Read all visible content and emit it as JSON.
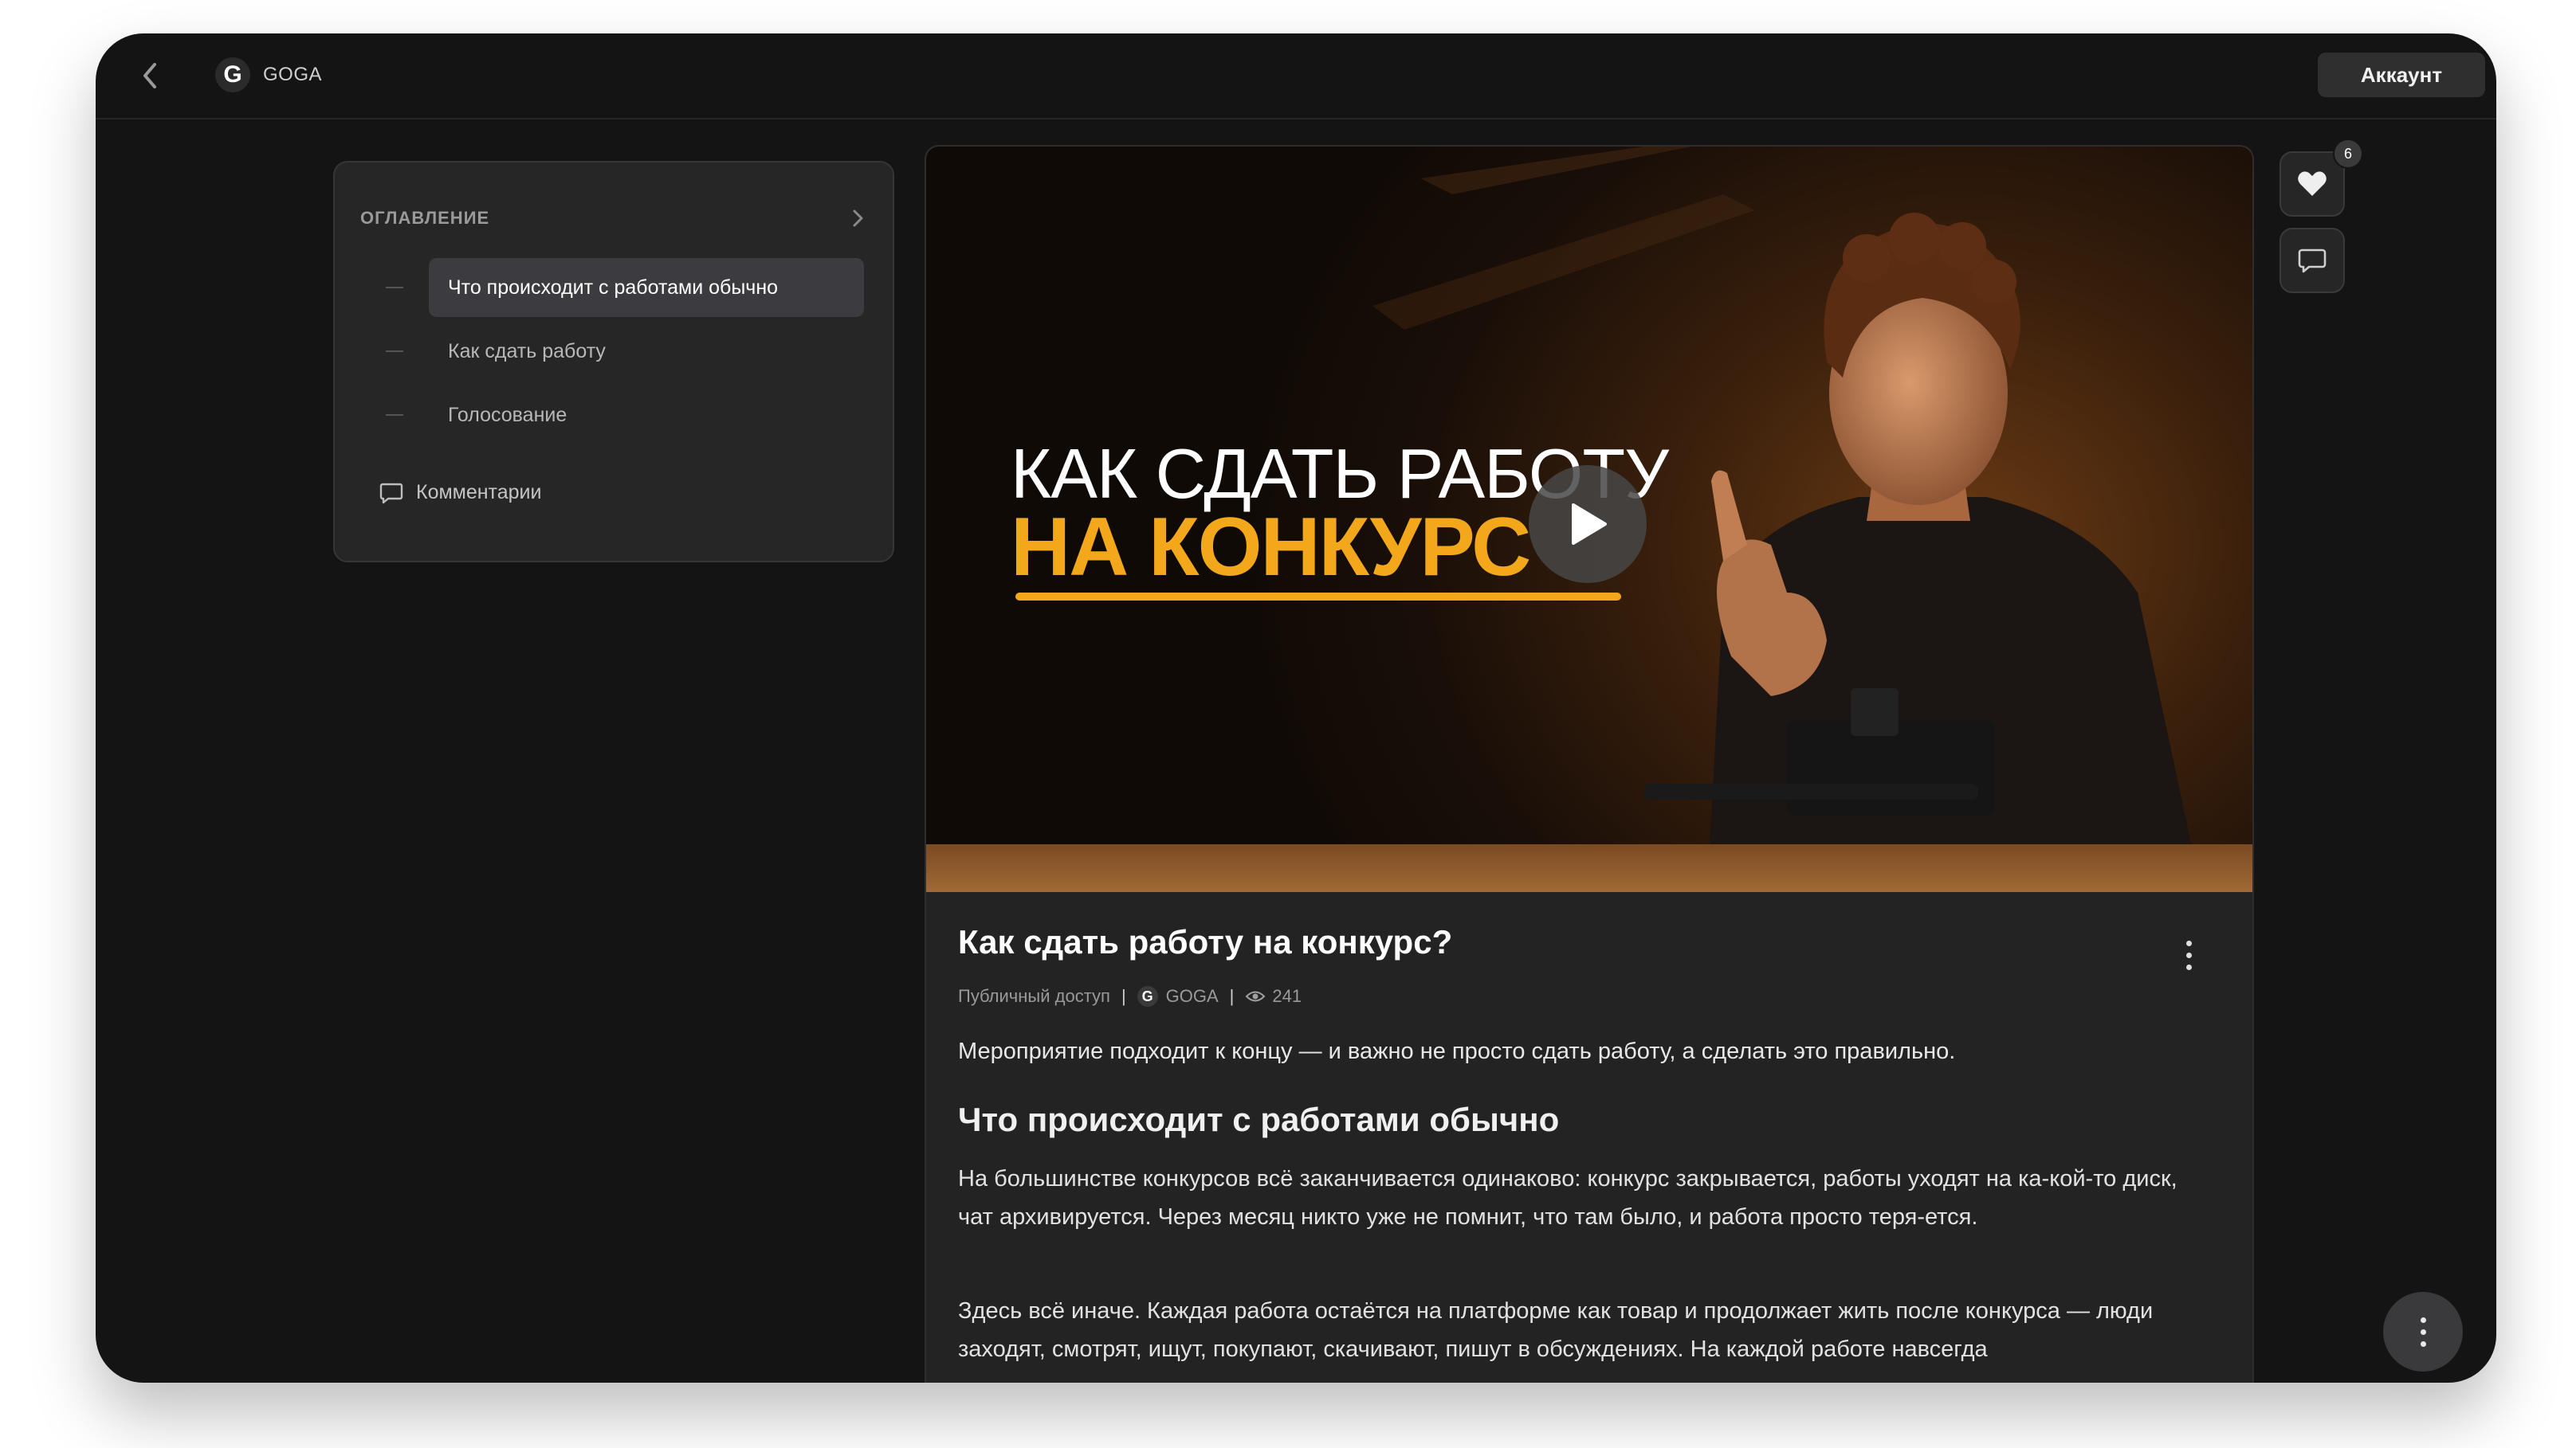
{
  "header": {
    "brand_name": "GOGA",
    "brand_logo_letter": "G",
    "account_label": "Аккаунт"
  },
  "toc": {
    "title": "ОГЛАВЛЕНИЕ",
    "items": [
      {
        "label": "Что происходит с работами обычно",
        "active": true
      },
      {
        "label": "Как сдать работу",
        "active": false
      },
      {
        "label": "Голосование",
        "active": false
      }
    ],
    "comments_label": "Комментарии"
  },
  "video": {
    "thumbnail_line1": "КАК СДАТЬ РАБОТУ",
    "thumbnail_line2": "НА КОНКУРС",
    "accent_color": "#f2a81a"
  },
  "post": {
    "title": "Как сдать работу на конкурс?",
    "access": "Публичный доступ",
    "author": "GOGA",
    "views": "241",
    "lead": "Мероприятие подходит к концу — и важно не просто сдать работу, а сделать это правильно.",
    "section_heading": "Что происходит с работами обычно",
    "paragraph1": "На большинстве конкурсов всё заканчивается одинаково: конкурс закрывается, работы уходят на ка-кой-то диск, чат архивируется. Через месяц никто уже не помнит, что там было, и работа просто теря-ется.",
    "paragraph2": "Здесь всё иначе. Каждая работа остаётся на платформе как товар и продолжает жить после конкурса — люди заходят, смотрят, ищут, покупают, скачивают, пишут в обсуждениях. На каждой работе навсегда"
  },
  "actions": {
    "likes_count": "6"
  }
}
